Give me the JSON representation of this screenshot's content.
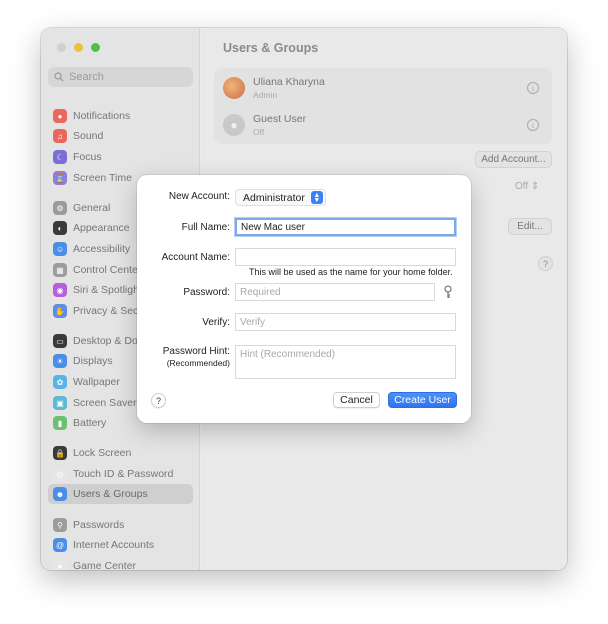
{
  "window": {
    "title": "Users & Groups",
    "search_placeholder": "Search"
  },
  "sidebar": {
    "items": [
      {
        "label": "Notifications",
        "icon": "bell-icon",
        "color": "#e8685e"
      },
      {
        "label": "Sound",
        "icon": "speaker-icon",
        "color": "#e8685e"
      },
      {
        "label": "Focus",
        "icon": "moon-icon",
        "color": "#7a6fd8"
      },
      {
        "label": "Screen Time",
        "icon": "hourglass-icon",
        "color": "#8b7fd6"
      },
      {
        "label": "General",
        "icon": "gear-icon",
        "color": "#9c9c9c"
      },
      {
        "label": "Appearance",
        "icon": "appearance-icon",
        "color": "#3a3a3a"
      },
      {
        "label": "Accessibility",
        "icon": "accessibility-icon",
        "color": "#4a8ee8"
      },
      {
        "label": "Control Center",
        "icon": "control-center-icon",
        "color": "#9c9c9c"
      },
      {
        "label": "Siri & Spotlight",
        "icon": "siri-icon",
        "color": "#b65fd6"
      },
      {
        "label": "Privacy & Security",
        "icon": "hand-icon",
        "color": "#5b8fe6"
      },
      {
        "label": "Desktop & Dock",
        "icon": "dock-icon",
        "color": "#3a3a3a"
      },
      {
        "label": "Displays",
        "icon": "sun-icon",
        "color": "#4a8ee8"
      },
      {
        "label": "Wallpaper",
        "icon": "flower-icon",
        "color": "#58b5e6"
      },
      {
        "label": "Screen Saver",
        "icon": "screen-saver-icon",
        "color": "#5fb9d4"
      },
      {
        "label": "Battery",
        "icon": "battery-icon",
        "color": "#6cc070"
      },
      {
        "label": "Lock Screen",
        "icon": "lock-icon",
        "color": "#3a3a3a"
      },
      {
        "label": "Touch ID & Password",
        "icon": "fingerprint-icon",
        "color": "#e6e6e6"
      },
      {
        "label": "Users & Groups",
        "icon": "users-icon",
        "color": "#4a8ee8"
      },
      {
        "label": "Passwords",
        "icon": "key-icon",
        "color": "#9c9c9c"
      },
      {
        "label": "Internet Accounts",
        "icon": "at-icon",
        "color": "#4a8ee8"
      },
      {
        "label": "Game Center",
        "icon": "game-center-icon",
        "color": "#e6e6e6"
      }
    ]
  },
  "users": [
    {
      "name": "Uliana Kharyna",
      "role": "Admin"
    },
    {
      "name": "Guest User",
      "role": "Off"
    }
  ],
  "background": {
    "add_account": "Add Account...",
    "off_value": "Off",
    "edit_label": "Edit...",
    "help": "?"
  },
  "dialog": {
    "new_account_label": "New Account:",
    "new_account_value": "Administrator",
    "full_name_label": "Full Name:",
    "full_name_value": "New Mac user",
    "account_name_label": "Account Name:",
    "account_name_value": "",
    "account_name_hint": "This will be used as the name for your home folder.",
    "password_label": "Password:",
    "password_placeholder": "Required",
    "verify_label": "Verify:",
    "verify_placeholder": "Verify",
    "hint_label": "Password Hint:",
    "hint_sublabel": "(Recommended)",
    "hint_placeholder": "Hint (Recommended)",
    "help": "?",
    "cancel": "Cancel",
    "create": "Create User"
  }
}
